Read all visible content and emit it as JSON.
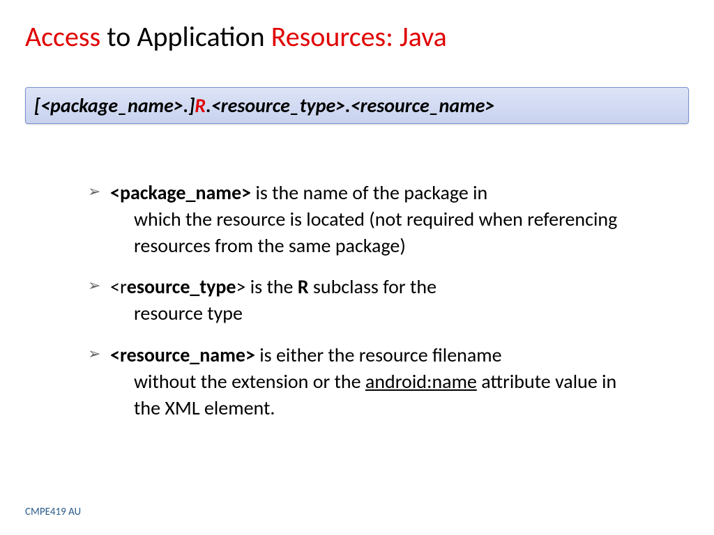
{
  "title": {
    "part1": "Access",
    "part2": " to Application ",
    "part3": "Resources: Java"
  },
  "syntax": {
    "part1": "[<package_name>.]",
    "part2": "R",
    "part3": ".<resource_type>.<resource_name>"
  },
  "bullets": [
    {
      "bold": "<package_name>",
      "line1_rest": " is the name of the package in",
      "line2": "which the resource is located (not required when referencing resources from the same package)"
    },
    {
      "prefix": "<r",
      "bold": "esource_type",
      "suffix": ">",
      "line1_rest": " is the ",
      "bold2": "R",
      "line1_rest2": " subclass for the",
      "line2": "resource type"
    },
    {
      "bold": "<resource_name>",
      "line1_rest": " is either the resource filename",
      "line2a": "without the extension or the ",
      "underline": "android:name",
      "line2b": " attribute value in the XML element."
    }
  ],
  "footer": "CMPE419 AU"
}
